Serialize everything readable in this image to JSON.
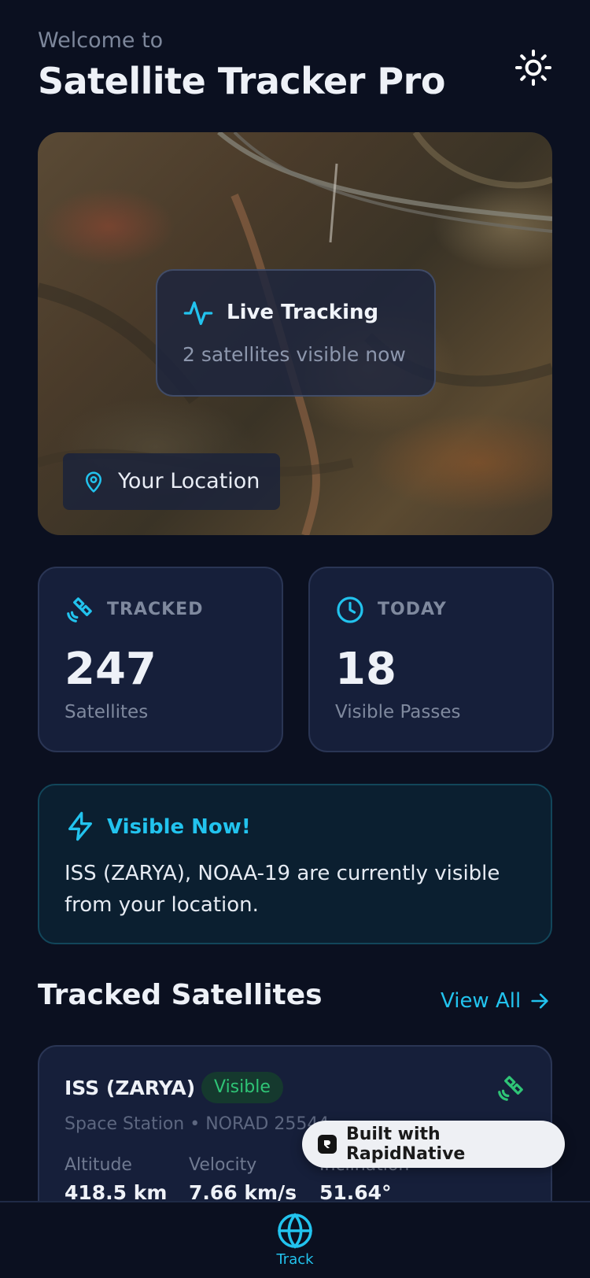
{
  "header": {
    "welcome": "Welcome to",
    "title": "Satellite Tracker Pro"
  },
  "hero": {
    "live_title": "Live Tracking",
    "live_subtitle": "2 satellites visible now",
    "location_label": "Your Location"
  },
  "stats": [
    {
      "label": "TRACKED",
      "value": "247",
      "caption": "Satellites",
      "icon": "satellite-icon"
    },
    {
      "label": "TODAY",
      "value": "18",
      "caption": "Visible Passes",
      "icon": "clock-icon"
    }
  ],
  "visible_now": {
    "title": "Visible Now!",
    "text": "ISS (ZARYA), NOAA-19 are currently visible from your location.",
    "icon": "lightning-icon"
  },
  "section": {
    "title": "Tracked Satellites",
    "view_all": "View All"
  },
  "satellites": [
    {
      "name": "ISS (ZARYA)",
      "status": "Visible",
      "meta": "Space Station • NORAD 25544",
      "stats": [
        {
          "label": "Altitude",
          "value": "418.5 km"
        },
        {
          "label": "Velocity",
          "value": "7.66 km/s"
        },
        {
          "label": "Inclination",
          "value": "51.64°"
        }
      ]
    }
  ],
  "badge": {
    "text": "Built with RapidNative"
  },
  "nav": {
    "tabs": [
      {
        "label": "Track",
        "icon": "globe-icon"
      }
    ]
  },
  "colors": {
    "background": "#0b1020",
    "accent": "#22c3ee",
    "card": "#161f3a",
    "success": "#2fc476"
  }
}
